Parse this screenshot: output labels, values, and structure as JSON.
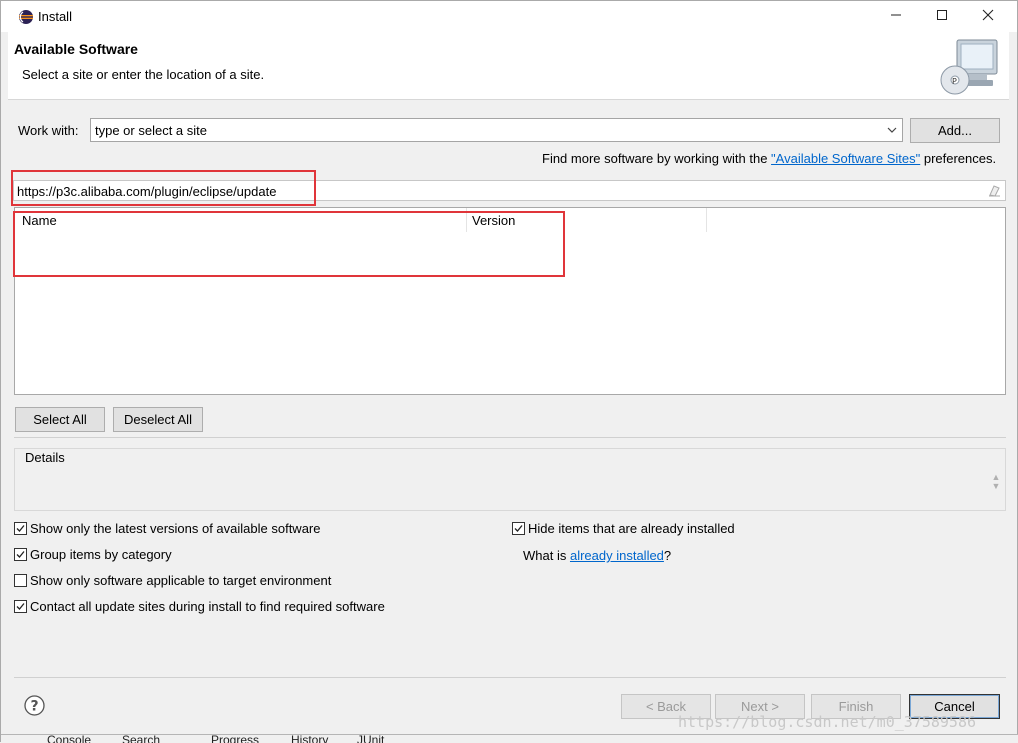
{
  "window": {
    "title": "Install"
  },
  "banner": {
    "title": "Available Software",
    "subtitle": "Select a site or enter the location of a site."
  },
  "work_with": {
    "label": "Work with:",
    "value": "type or select a site",
    "add_label": "Add..."
  },
  "find_more": {
    "prefix": "Find more software by working with the ",
    "link": "\"Available Software Sites\"",
    "suffix": " preferences."
  },
  "filter": {
    "value": "https://p3c.alibaba.com/plugin/eclipse/update"
  },
  "table": {
    "columns": [
      "Name",
      "Version"
    ]
  },
  "buttons": {
    "select_all": "Select All",
    "deselect_all": "Deselect All",
    "back": "< Back",
    "next": "Next >",
    "finish": "Finish",
    "cancel": "Cancel"
  },
  "details": {
    "label": "Details"
  },
  "options": {
    "left": [
      {
        "label": "Show only the latest versions of available software",
        "checked": true
      },
      {
        "label": "Group items by category",
        "checked": true
      },
      {
        "label": "Show only software applicable to target environment",
        "checked": false
      },
      {
        "label": "Contact all update sites during install to find required software",
        "checked": true
      }
    ],
    "right": [
      {
        "label": "Hide items that are already installed",
        "checked": true
      }
    ],
    "installed_prefix": "What is ",
    "installed_link": "already installed",
    "installed_suffix": "?"
  },
  "watermark": "https://blog.csdn.net/m0_37589586",
  "background_tabs": [
    "Console",
    "Search",
    "Progress",
    "History",
    "JUnit"
  ],
  "colors": {
    "highlight_box": "#e0353a",
    "link": "#0066cc"
  }
}
